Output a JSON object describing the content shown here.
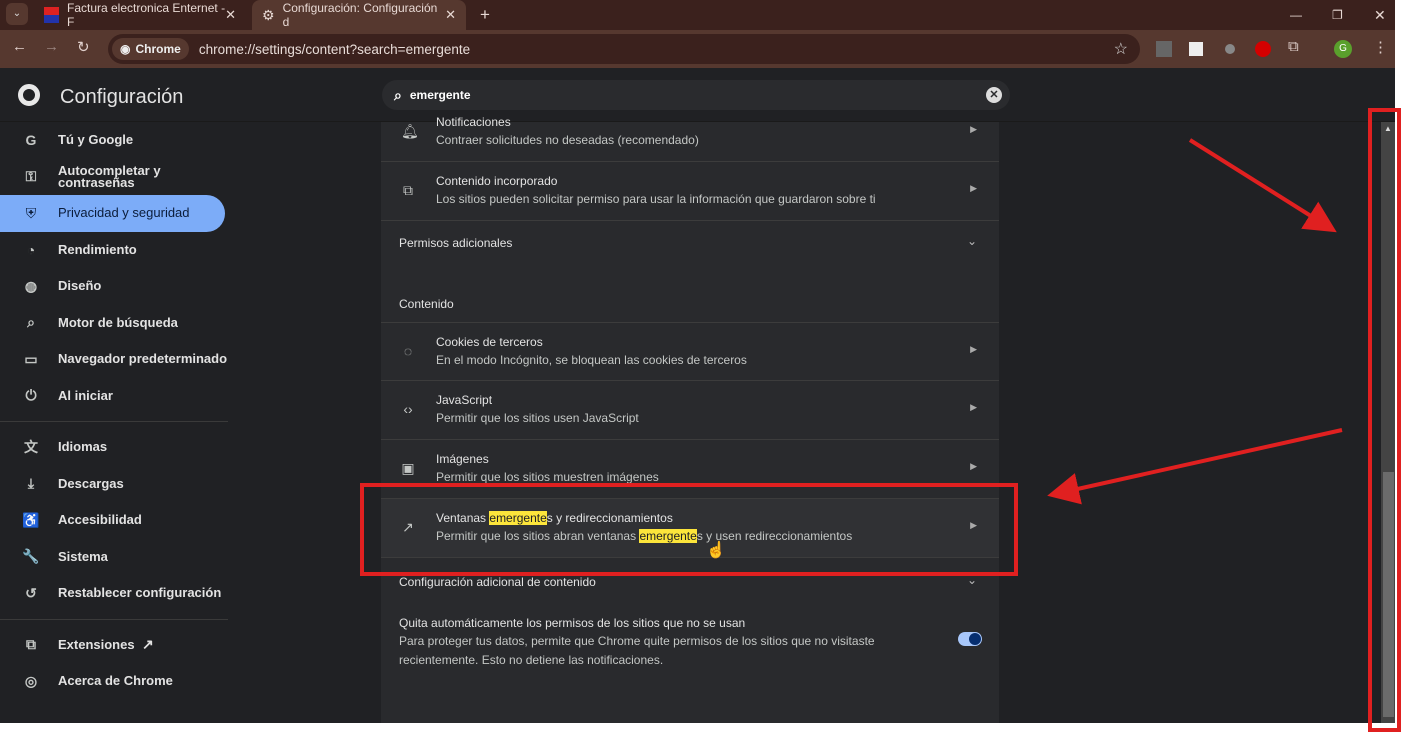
{
  "browser": {
    "tabs": [
      {
        "label": "Factura electronica Enternet - F",
        "active": false
      },
      {
        "label": "Configuración: Configuración d",
        "active": true
      }
    ],
    "new_tab": "+",
    "chip": "Chrome",
    "url": "chrome://settings/content?search=emergente",
    "profile_initial": "G"
  },
  "header": {
    "title": "Configuración",
    "search_value": "emergente"
  },
  "sidebar": {
    "items": [
      {
        "label": "Tú y Google",
        "icon": "G"
      },
      {
        "label": "Autocompletar y contraseñas",
        "icon": "⚿"
      },
      {
        "label": "Privacidad y seguridad",
        "icon": "⛨",
        "selected": true
      },
      {
        "label": "Rendimiento",
        "icon": "◔"
      },
      {
        "label": "Diseño",
        "icon": "◍"
      },
      {
        "label": "Motor de búsqueda",
        "icon": "⌕"
      },
      {
        "label": "Navegador predeterminado",
        "icon": "▭"
      },
      {
        "label": "Al iniciar",
        "icon": "⏻"
      },
      {
        "label": "Idiomas",
        "icon": "文"
      },
      {
        "label": "Descargas",
        "icon": "⤓"
      },
      {
        "label": "Accesibilidad",
        "icon": "♿"
      },
      {
        "label": "Sistema",
        "icon": "🔧"
      },
      {
        "label": "Restablecer configuración",
        "icon": "↺"
      },
      {
        "label": "Extensiones",
        "icon": "⧉"
      },
      {
        "label": "Acerca de Chrome",
        "icon": "◎"
      }
    ]
  },
  "content": {
    "rows_top": [
      {
        "title": "Notificaciones",
        "sub": "Contraer solicitudes no deseadas (recomendado)",
        "icon": "bell"
      },
      {
        "title": "Contenido incorporado",
        "sub": "Los sitios pueden solicitar permiso para usar la información que guardaron sobre ti",
        "icon": "embed"
      }
    ],
    "permisos_adicionales": "Permisos adicionales",
    "contenido": "Contenido",
    "rows": [
      {
        "title": "Cookies de terceros",
        "sub": "En el modo Incógnito, se bloquean las cookies de terceros",
        "icon": "cookie"
      },
      {
        "title": "JavaScript",
        "sub": "Permitir que los sitios usen JavaScript",
        "icon": "code"
      },
      {
        "title": "Imágenes",
        "sub": "Permitir que los sitios muestren imágenes",
        "icon": "image"
      }
    ],
    "popups": {
      "t1": "Ventanas ",
      "t_hl": "emergente",
      "t2": "s y redireccionamientos",
      "s1": "Permitir que los sitios abran ventanas ",
      "s_hl": "emergente",
      "s2": "s y usen redireccionamientos"
    },
    "config_adicional": "Configuración adicional de contenido",
    "auto_revoke": {
      "title": "Quita automáticamente los permisos de los sitios que no se usan",
      "desc1": "Para proteger tus datos, permite que Chrome quite permisos de los sitios que no visitaste",
      "desc2": "recientemente. Esto no detiene las notificaciones.",
      "enabled": true
    }
  },
  "annotation_color": "#e02020"
}
